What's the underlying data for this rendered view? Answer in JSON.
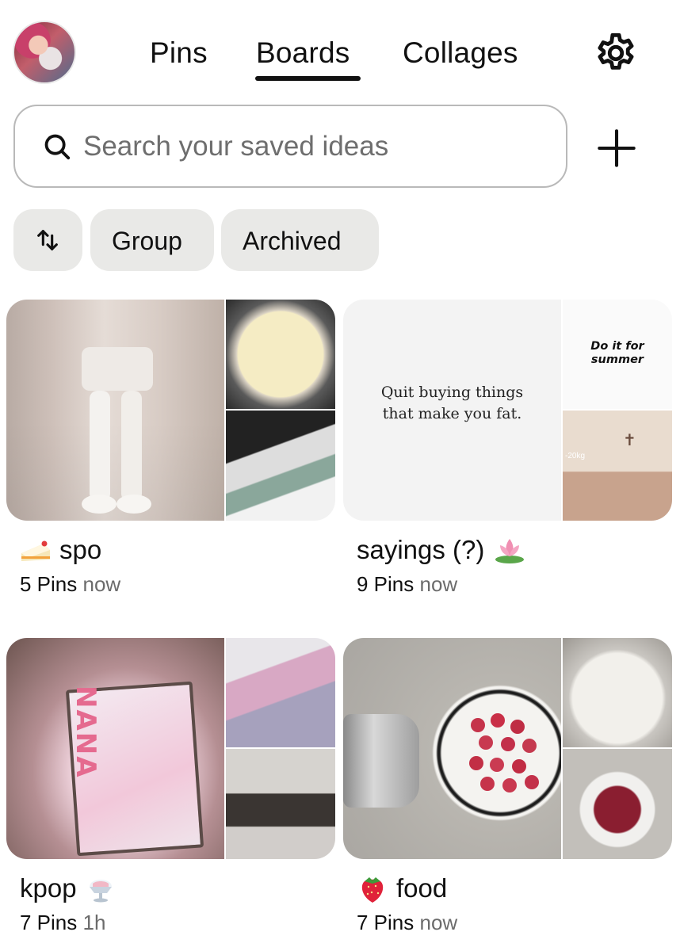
{
  "header": {
    "tabs": [
      {
        "label": "Pins",
        "active": false
      },
      {
        "label": "Boards",
        "active": true
      },
      {
        "label": "Collages",
        "active": false
      }
    ]
  },
  "search": {
    "placeholder": "Search your saved ideas",
    "value": ""
  },
  "filters": [
    {
      "label": "Group"
    },
    {
      "label": "Archived"
    }
  ],
  "boards": [
    {
      "title": "spo",
      "emoji": "cake-slice-icon",
      "emoji_position": "before",
      "pin_count": "5 Pins",
      "time": "now"
    },
    {
      "title": "sayings (?)",
      "emoji": "lotus-icon",
      "emoji_position": "after",
      "pin_count": "9 Pins",
      "time": "now",
      "images_text": {
        "main_quote": "Quit buying things that make you fat.",
        "top_text": "Do it for summer",
        "bottom_text": "-20kg"
      }
    },
    {
      "title": "kpop",
      "emoji": "shaved-ice-icon",
      "emoji_position": "after",
      "pin_count": "7 Pins",
      "time": "1h",
      "images_text": {
        "main_text": "NANA"
      }
    },
    {
      "title": "food",
      "emoji": "strawberry-icon",
      "emoji_position": "before",
      "pin_count": "7 Pins",
      "time": "now"
    }
  ],
  "colors": {
    "text": "#111111",
    "muted": "#6b6b6b",
    "chip_bg": "#e9e9e7",
    "search_border": "#b9b9b9"
  }
}
